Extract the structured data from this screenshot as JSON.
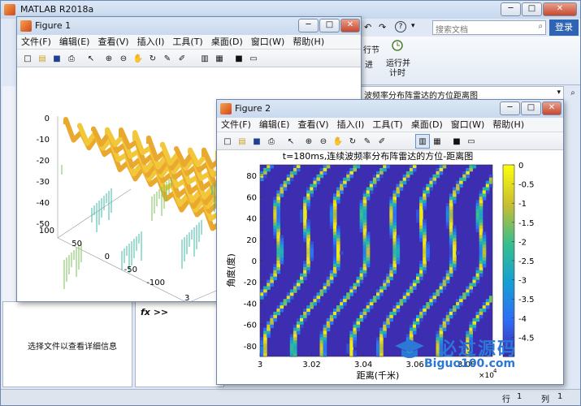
{
  "main_window": {
    "title": "MATLAB R2018a",
    "search_placeholder": "搜索文档",
    "login_label": "登录",
    "ribbon_partial_label_1": "行节",
    "ribbon_partial_label_2": "进",
    "run_time_label_line1": "运行并",
    "run_time_label_line2": "计时",
    "path_partial": "波频率分布阵雷达的方位距离图",
    "details_text": "选择文件以查看详细信息",
    "command_prompt": "fx >>",
    "status_row_label": "行",
    "status_row_value": "1",
    "status_col_label": "列",
    "status_col_value": "1"
  },
  "figure1": {
    "title": "Figure 1",
    "menu": [
      "文件(F)",
      "编辑(E)",
      "查看(V)",
      "插入(I)",
      "工具(T)",
      "桌面(D)",
      "窗口(W)",
      "帮助(H)"
    ],
    "z_ticks": [
      "0",
      "-10",
      "-20",
      "-30",
      "-40",
      "-50"
    ],
    "y_ticks": [
      "100",
      "50",
      "0",
      "-50",
      "-100"
    ],
    "x_tick": "3"
  },
  "figure2": {
    "title": "Figure 2",
    "menu": [
      "文件(F)",
      "编辑(E)",
      "查看(V)",
      "插入(I)",
      "工具(T)",
      "桌面(D)",
      "窗口(W)",
      "帮助(H)"
    ]
  },
  "chart_data": {
    "type": "heatmap",
    "title": "t=180ms,连续波频率分布阵雷达的方位-距离图",
    "xlabel": "距离(千米)",
    "ylabel": "角度(度)",
    "x_tick_labels": [
      "3",
      "3.02",
      "3.04",
      "3.06",
      "3.08"
    ],
    "x_exponent_label": "×10",
    "x_exponent_power": "4",
    "y_tick_labels": [
      "80",
      "60",
      "40",
      "20",
      "0",
      "-20",
      "-40",
      "-60",
      "-80"
    ],
    "colorbar_tick_labels": [
      "0",
      "-0.5",
      "-1",
      "-1.5",
      "-2",
      "-2.5",
      "-3",
      "-3.5",
      "-4",
      "-4.5"
    ],
    "xlim": [
      30000,
      30900
    ],
    "ylim": [
      -90,
      90
    ],
    "clim": [
      -5,
      0
    ],
    "colormap": "parula"
  },
  "watermark": {
    "text_cn": "必过源码",
    "text_en": "Biguo100.com"
  },
  "colors": {
    "accent": "#1f5fb8",
    "title_bar": "#c9d9ee",
    "heat_low": "#3e26a8",
    "heat_mid": "#21a8c8",
    "heat_high": "#f9fb0e"
  }
}
